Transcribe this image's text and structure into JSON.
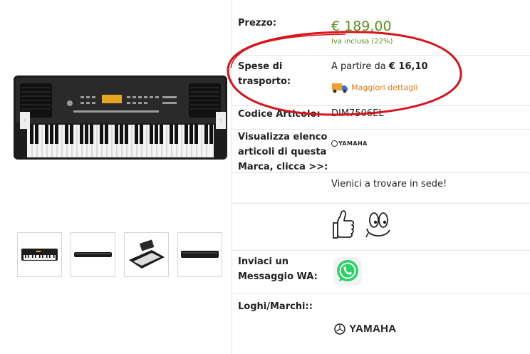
{
  "gallery": {
    "thumbnails": [
      "keyboard-front",
      "keyboard-side",
      "keyboard-angle",
      "keyboard-top"
    ]
  },
  "details": {
    "price_label": "Prezzo:",
    "price_value": "€ 189,00",
    "vat_note": "Iva inclusa (22%)",
    "shipping_label_line1": "Spese di",
    "shipping_label_line2": "trasporto:",
    "shipping_prefix": "A partire da",
    "shipping_value": "€ 16,10",
    "shipping_more_link": "Maggiori dettagli",
    "code_label": "Codice Articolo:",
    "code_value": "DIM7506EL",
    "brand_list_label_line1": "Visualizza elenco",
    "brand_list_label_line2": "articoli di questa",
    "brand_list_label_line3": "Marca, clicca >>:",
    "brand_small": "YAMAHA",
    "visit_text": "Vienici a trovare in sede!",
    "whatsapp_label_line1": "Inviaci un",
    "whatsapp_label_line2": "Messaggio WA:",
    "logos_label": "Loghi/Marchi::",
    "brand_logo": "YAMAHA"
  },
  "colors": {
    "price_green": "#5b8e1e",
    "link_orange": "#e07b12",
    "highlight_red": "#d8131b",
    "whatsapp_green": "#25d366"
  }
}
